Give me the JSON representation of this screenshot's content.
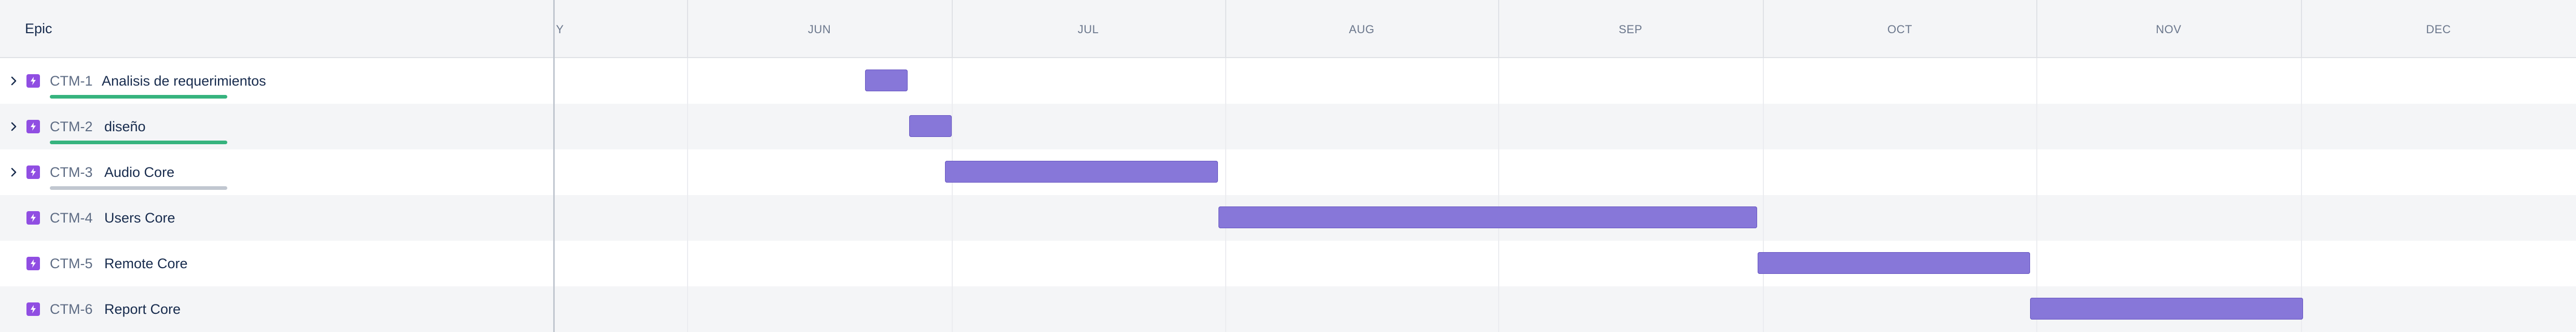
{
  "roadmap": {
    "epic_column_header": "Epic",
    "months": [
      "Y",
      "JUN",
      "JUL",
      "AUG",
      "SEP",
      "OCT",
      "NOV",
      "DEC"
    ],
    "colors": {
      "epic_icon": "#904ee2",
      "bar": "#8777d9",
      "progress_done": "#36b37e",
      "progress_track": "#c1c7d0"
    },
    "epics": [
      {
        "key": "CTM-1",
        "title": "Analisis de requerimientos",
        "expandable": true,
        "progress": 1.0,
        "show_progress": true,
        "icon": "epic-lightning-icon"
      },
      {
        "key": "CTM-2",
        "title": "diseño",
        "expandable": true,
        "progress": 1.0,
        "show_progress": true,
        "icon": "epic-lightning-icon"
      },
      {
        "key": "CTM-3",
        "title": "Audio Core",
        "expandable": true,
        "progress": 0.0,
        "show_progress": true,
        "icon": "epic-lightning-icon"
      },
      {
        "key": "CTM-4",
        "title": "Users Core",
        "expandable": false,
        "progress": 0,
        "show_progress": false,
        "icon": "epic-lightning-icon"
      },
      {
        "key": "CTM-5",
        "title": "Remote Core",
        "expandable": false,
        "progress": 0,
        "show_progress": false,
        "icon": "epic-lightning-icon"
      },
      {
        "key": "CTM-6",
        "title": "Report Core",
        "expandable": false,
        "progress": 0,
        "show_progress": false,
        "icon": "epic-lightning-icon"
      }
    ]
  }
}
